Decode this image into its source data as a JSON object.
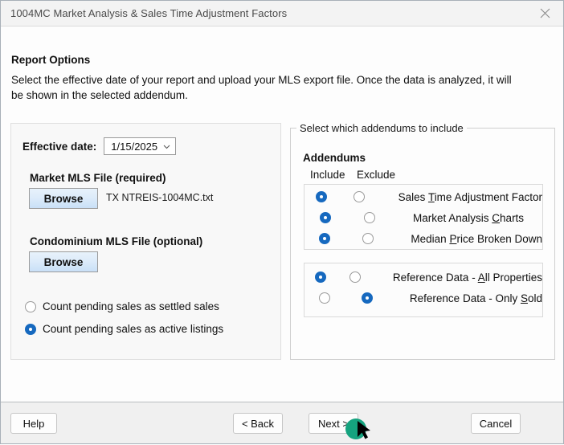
{
  "window": {
    "title": "1004MC Market Analysis & Sales Time Adjustment Factors",
    "close_icon": "close-icon"
  },
  "header": {
    "section_title": "Report Options",
    "intro": "Select the effective date of your report and upload your MLS export file.  Once the data is analyzed, it will be shown in the selected addendum."
  },
  "left_panel": {
    "effective_date_label": "Effective date:",
    "effective_date_value": "1/15/2025",
    "market_file_label": "Market MLS File (required)",
    "market_browse_label": "Browse",
    "market_file_name": "TX NTREIS-1004MC.txt",
    "condo_file_label": "Condominium MLS File (optional)",
    "condo_browse_label": "Browse",
    "pending_options": [
      {
        "label": "Count pending sales as settled sales",
        "selected": false
      },
      {
        "label": "Count pending sales as active listings",
        "selected": true
      }
    ]
  },
  "right_panel": {
    "groupbox_label": "Select which addendums to include",
    "addendums_title": "Addendums",
    "column_include": "Include",
    "column_exclude": "Exclude",
    "addendum_rows": [
      {
        "label_pre": "Sales ",
        "accel": "T",
        "label_post": "ime Adjustment Factor",
        "include": true,
        "exclude": false
      },
      {
        "label_pre": "Market Analysis ",
        "accel": "C",
        "label_post": "harts",
        "include": true,
        "exclude": false
      },
      {
        "label_pre": "Median ",
        "accel": "P",
        "label_post": "rice Broken Down",
        "include": true,
        "exclude": false
      }
    ],
    "reference_rows": [
      {
        "label_pre": "Reference Data - ",
        "accel": "A",
        "label_post": "ll Properties",
        "include": true,
        "exclude": false
      },
      {
        "label_pre": "Reference Data - Only ",
        "accel": "S",
        "label_post": "old",
        "include": false,
        "exclude": true
      }
    ]
  },
  "footer": {
    "help_label": "Help",
    "back_label": "< Back",
    "next_label": "Next >",
    "cancel_label": "Cancel"
  },
  "colors": {
    "accent_blue": "#1669bf",
    "cursor_highlight": "#15a37f",
    "button_blue_top": "#e8f2fb",
    "button_blue_bottom": "#c9e0f7"
  }
}
